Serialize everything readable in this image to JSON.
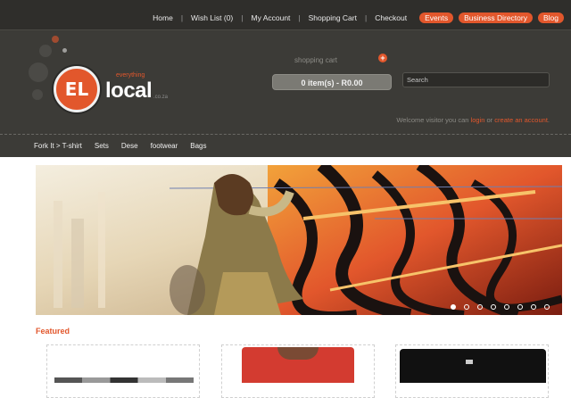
{
  "top_nav": {
    "links": [
      "Home",
      "Wish List (0)",
      "My Account",
      "Shopping Cart",
      "Checkout"
    ],
    "pills": [
      "Events",
      "Business Directory",
      "Blog"
    ]
  },
  "logo": {
    "word": "local",
    "tagline": "everything",
    "suffix": ".co.za",
    "mark": "EL"
  },
  "cart": {
    "title": "shopping cart",
    "summary": "0 item(s) - R0.00"
  },
  "search": {
    "placeholder": "Search"
  },
  "welcome": {
    "prefix": "Welcome visitor you can",
    "login": "login",
    "or": "or",
    "create": "create an account",
    "suffix": "."
  },
  "category_nav": [
    "Fork It > T-shirt",
    "Sets",
    "Dese",
    "footwear",
    "Bags"
  ],
  "slider": {
    "slides": 8,
    "active_index": 0
  },
  "featured_title": "Featured",
  "colors": {
    "accent": "#e2572c",
    "header": "#3c3b37",
    "topbar": "#2f2e2b"
  }
}
